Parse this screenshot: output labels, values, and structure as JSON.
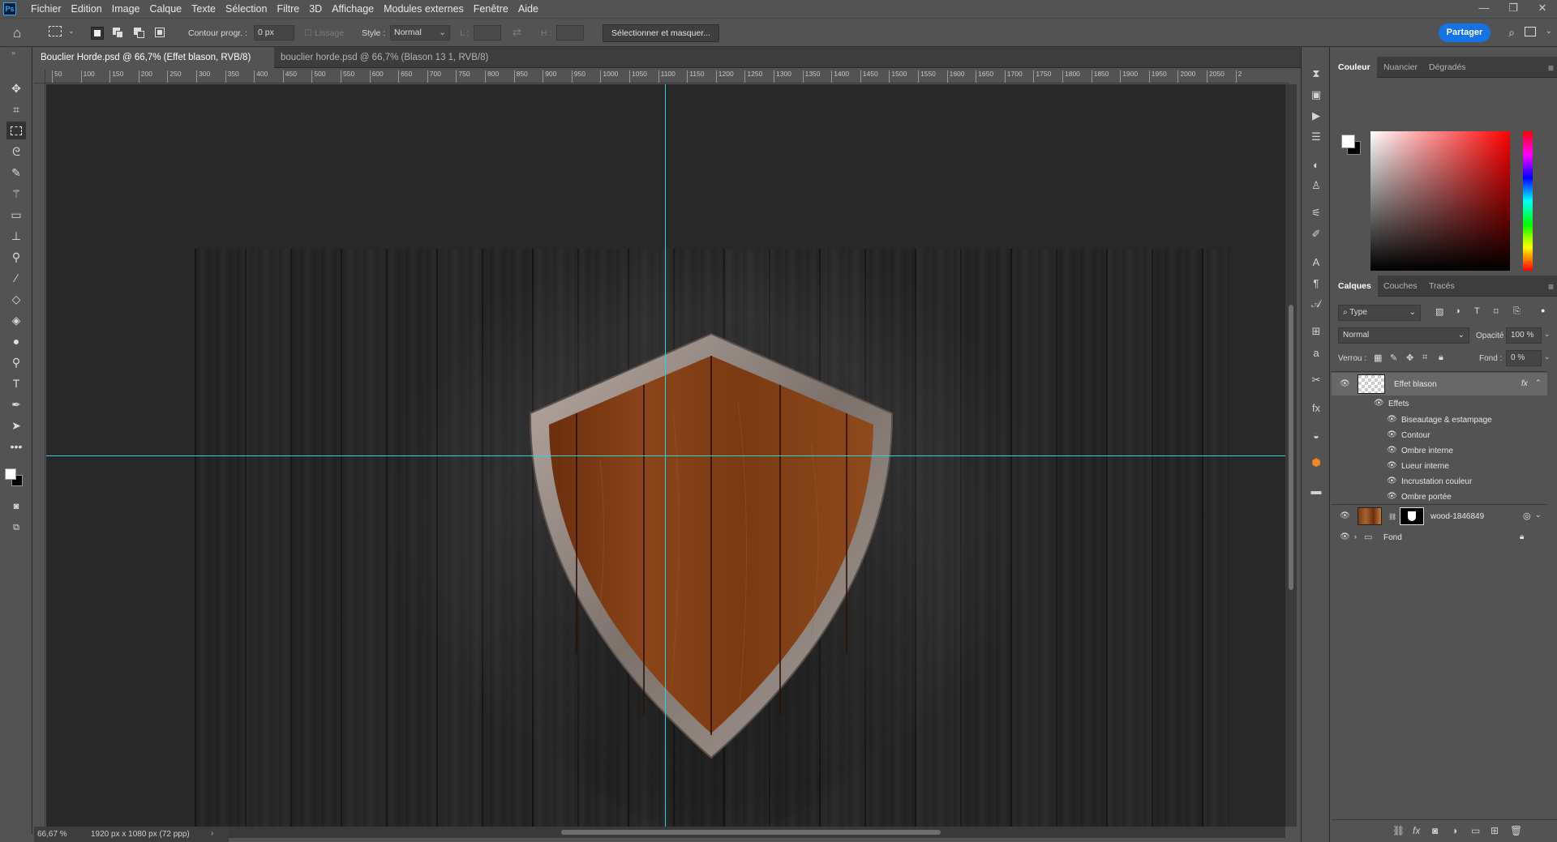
{
  "menu": [
    "Fichier",
    "Edition",
    "Image",
    "Calque",
    "Texte",
    "Sélection",
    "Filtre",
    "3D",
    "Affichage",
    "Modules externes",
    "Fenêtre",
    "Aide"
  ],
  "app_logo": "Ps",
  "window_controls": [
    "—",
    "❐",
    "✕"
  ],
  "options": {
    "feather_label": "Contour progr. :",
    "feather_value": "0 px",
    "antialias_label": "Lissage",
    "style_label": "Style :",
    "style_value": "Normal",
    "width_label": "L :",
    "height_label": "H :",
    "select_mask_button": "Sélectionner et masquer...",
    "share_button": "Partager"
  },
  "tabs": [
    {
      "label": "Bouclier Horde.psd @ 66,7% (Effet blason, RVB/8) *",
      "active": true
    },
    {
      "label": "bouclier horde.psd @ 66,7% (Blason 13 1, RVB/8) *",
      "active": false
    }
  ],
  "ruler_ticks": [
    "50",
    "100",
    "150",
    "200",
    "250",
    "300",
    "350",
    "400",
    "450",
    "500",
    "550",
    "600",
    "650",
    "700",
    "750",
    "800",
    "850",
    "900",
    "950",
    "1000",
    "1050",
    "1100",
    "1150",
    "1200",
    "1250",
    "1300",
    "1350",
    "1400",
    "1450",
    "1500",
    "1550",
    "1600",
    "1650",
    "1700",
    "1750",
    "1800",
    "1850",
    "1900",
    "1950",
    "2000",
    "2050",
    "2"
  ],
  "status": {
    "zoom": "66,67 %",
    "doc_info": "1920 px x 1080 px (72 ppp)"
  },
  "color_panel": {
    "tabs": [
      "Couleur",
      "Nuancier",
      "Dégradés"
    ],
    "foreground": "#ffffff",
    "background": "#000000"
  },
  "layers_panel": {
    "tabs": [
      "Calques",
      "Couches",
      "Tracés"
    ],
    "filter_kind": "Type",
    "blend_mode": "Normal",
    "opacity_label": "Opacité :",
    "opacity_value": "100 %",
    "lock_label": "Verrou :",
    "fill_label": "Fond :",
    "fill_value": "0 %",
    "layers": [
      {
        "name": "Effet blason",
        "selected": true,
        "fx": "fx"
      },
      {
        "name": "wood-1846849",
        "selected": false
      }
    ],
    "effects_label": "Effets",
    "effects": [
      "Biseautage & estampage",
      "Contour",
      "Ombre interne",
      "Lueur interne",
      "Incrustation couleur",
      "Ombre portée"
    ],
    "group": "Fond"
  },
  "guide_color": "#29d3e0",
  "accent": "#1473e6"
}
